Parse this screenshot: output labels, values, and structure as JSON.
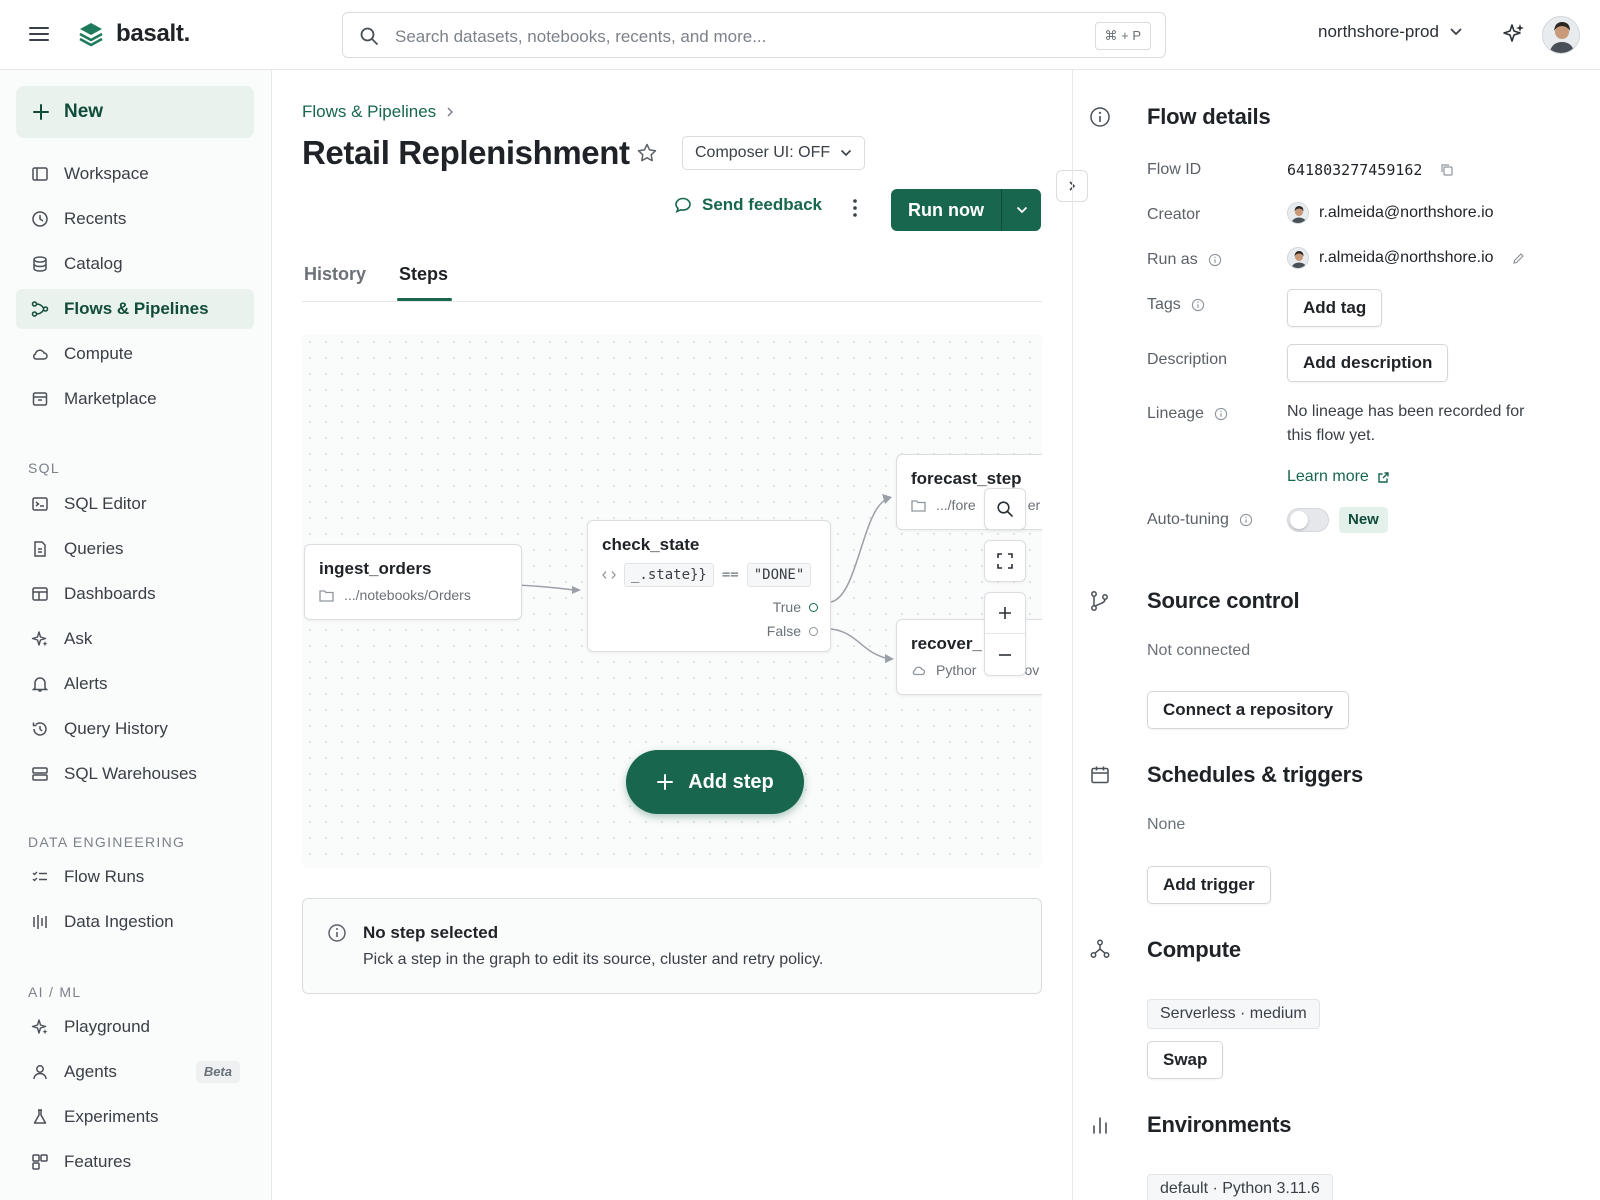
{
  "brand": {
    "name": "basalt."
  },
  "search": {
    "placeholder": "Search datasets, notebooks, recents, and more...",
    "shortcut": "⌘ + P"
  },
  "workspace": {
    "name": "northshore-prod"
  },
  "sidebar": {
    "new_label": "New",
    "items": [
      {
        "label": "Workspace"
      },
      {
        "label": "Recents"
      },
      {
        "label": "Catalog"
      },
      {
        "label": "Flows & Pipelines"
      },
      {
        "label": "Compute"
      },
      {
        "label": "Marketplace"
      }
    ],
    "sql_section": "SQL",
    "sql_items": [
      {
        "label": "SQL Editor"
      },
      {
        "label": "Queries"
      },
      {
        "label": "Dashboards"
      },
      {
        "label": "Ask"
      },
      {
        "label": "Alerts"
      },
      {
        "label": "Query History"
      },
      {
        "label": "SQL Warehouses"
      }
    ],
    "de_section": "DATA ENGINEERING",
    "de_items": [
      {
        "label": "Flow Runs"
      },
      {
        "label": "Data Ingestion"
      }
    ],
    "ml_section": "AI / ML",
    "ml_items": [
      {
        "label": "Playground"
      },
      {
        "label": "Agents",
        "badge": "Beta"
      },
      {
        "label": "Experiments"
      },
      {
        "label": "Features"
      }
    ]
  },
  "main": {
    "breadcrumb": "Flows & Pipelines",
    "title": "Retail Replenishment",
    "composer_label": "Composer UI: OFF",
    "feedback_label": "Send feedback",
    "run_label": "Run now",
    "tabs": [
      {
        "label": "History"
      },
      {
        "label": "Steps"
      }
    ],
    "active_tab": "Steps",
    "graph": {
      "nodes": [
        {
          "id": "ingest_orders",
          "title": "ingest_orders",
          "subtitle": ".../notebooks/Orders"
        },
        {
          "id": "check_state",
          "title": "check_state",
          "expr_left": "_.state}}",
          "operator": "==",
          "expr_right": "\"DONE\"",
          "true_label": "True",
          "false_label": "False"
        },
        {
          "id": "forecast_step",
          "title": "forecast_step",
          "subtitle": ".../fore",
          "subtitle_tail": "er"
        },
        {
          "id": "recover",
          "title": "recover_",
          "subtitle": "Pythor",
          "subtitle_tail": "ov"
        }
      ],
      "add_step_label": "Add step"
    },
    "info": {
      "title": "No step selected",
      "text": "Pick a step in the graph to edit its source, cluster and retry policy."
    }
  },
  "details": {
    "heading": "Flow details",
    "flow_id_label": "Flow ID",
    "flow_id": "641803277459162",
    "creator_label": "Creator",
    "creator": "r.almeida@northshore.io",
    "run_as_label": "Run as",
    "run_as": "r.almeida@northshore.io",
    "tags_label": "Tags",
    "add_tag": "Add tag",
    "description_label": "Description",
    "add_description": "Add description",
    "lineage_label": "Lineage",
    "lineage_line1": "No lineage has been recorded for",
    "lineage_line2": "this flow yet.",
    "learn_more": "Learn more",
    "autotuning_label": "Auto-tuning",
    "autotuning_enabled": false,
    "new_badge": "New"
  },
  "source_control": {
    "heading": "Source control",
    "status": "Not connected",
    "connect_label": "Connect a repository"
  },
  "schedules": {
    "heading": "Schedules & triggers",
    "status": "None",
    "add_label": "Add trigger"
  },
  "compute": {
    "heading": "Compute",
    "value": "Serverless · medium",
    "swap_label": "Swap"
  },
  "environments": {
    "heading": "Environments",
    "value": "default · Python 3.11.6"
  },
  "colors": {
    "accent": "#17664d",
    "accent_bg": "#eaf2ee"
  }
}
